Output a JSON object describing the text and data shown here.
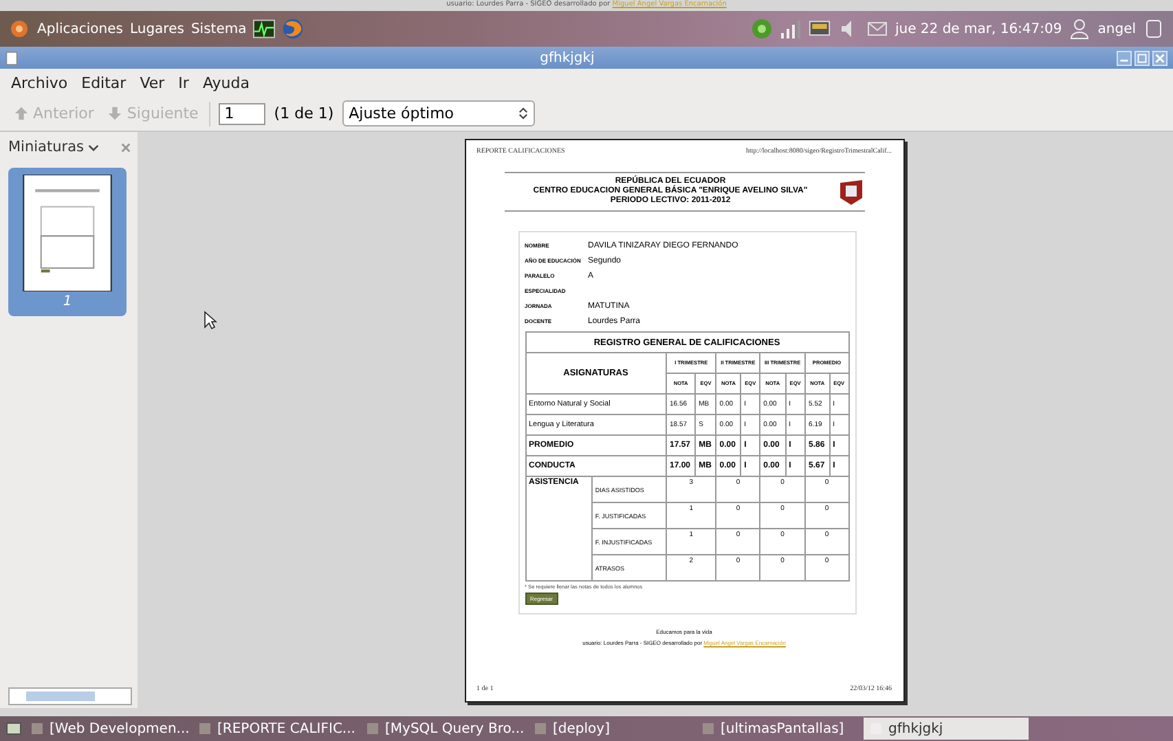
{
  "top_panel": {
    "banner": "usuario: Lourdes Parra - SIGEO desarrollado por",
    "banner_link": "Miguel Angel Vargas Encarnación",
    "menus": [
      "Aplicaciones",
      "Lugares",
      "Sistema"
    ],
    "clock": "jue 22 de mar, 16:47:09",
    "user": "angel"
  },
  "window": {
    "title": "gfhkjgkj"
  },
  "menu_bar": [
    "Archivo",
    "Editar",
    "Ver",
    "Ir",
    "Ayuda"
  ],
  "toolbar": {
    "buttons": [
      {
        "label": "Anterior",
        "kind": "up",
        "disabled": true
      },
      {
        "label": "Siguiente",
        "kind": "down",
        "disabled": true
      }
    ],
    "page_field": "1",
    "page_count": "(1 de 1)",
    "zoom": "Ajuste óptimo"
  },
  "sidebar": {
    "title": "Miniaturas",
    "thumbnails": [
      {
        "label": "1",
        "selected": true
      }
    ]
  },
  "document": {
    "header_left": "REPORTE CALIFICACIONES",
    "header_right": "http://localhost:8080/sigeo/RegistroTrimestralCalif...",
    "title_lines": [
      "REPÚBLICA DEL ECUADOR",
      "CENTRO EDUCACION GENERAL BÁSICA \"ENRIQUE AVELINO SILVA\"",
      "PERIODO LECTIVO: 2011-2012"
    ],
    "fields": [
      {
        "label": "NOMBRE",
        "value": "DAVILA TINIZARAY DIEGO FERNANDO"
      },
      {
        "label": "AÑO DE EDUCACIÓN",
        "value": "Segundo"
      },
      {
        "label": "PARALELO",
        "value": "A"
      },
      {
        "label": "ESPECIALIDAD"
      },
      {
        "label": "JORNADA",
        "value": "MATUTINA"
      },
      {
        "label": "DOCENTE",
        "value": "Lourdes Parra"
      }
    ],
    "table": {
      "title": "REGISTRO GENERAL DE CALIFICACIONES",
      "subject_header": "ASIGNATURAS",
      "terms": [
        "I TRIMESTRE",
        "II TRIMESTRE",
        "III TRIMESTRE",
        "PROMEDIO"
      ],
      "subheaders": [
        "NOTA",
        "EQV",
        "NOTA",
        "EQV",
        "NOTA",
        "EQV",
        "NOTA",
        "EQV"
      ],
      "rows": [
        {
          "subject": "Entorno Natural y Social",
          "kind": "subject",
          "cells": [
            "16.56",
            "MB",
            "0.00",
            "I",
            "0.00",
            "I",
            "5.52",
            "I"
          ]
        },
        {
          "subject": "Lengua y Literatura",
          "kind": "subject",
          "cells": [
            "18.57",
            "S",
            "0.00",
            "I",
            "0.00",
            "I",
            "6.19",
            "I"
          ]
        },
        {
          "subject": "PROMEDIO",
          "kind": "summary",
          "cells": [
            "17.57",
            "MB",
            "0.00",
            "I",
            "0.00",
            "I",
            "5.86",
            "I"
          ]
        },
        {
          "subject": "CONDUCTA",
          "kind": "summary",
          "cells": [
            "17.00",
            "MB",
            "0.00",
            "I",
            "0.00",
            "I",
            "5.67",
            "I"
          ]
        }
      ],
      "attendance": {
        "label": "ASISTENCIA",
        "rows": [
          {
            "label": "DIAS ASISTIDOS",
            "values": [
              "3",
              "0",
              "0",
              "0"
            ]
          },
          {
            "label": "F. JUSTIFICADAS",
            "values": [
              "1",
              "0",
              "0",
              "0"
            ]
          },
          {
            "label": "F. INJUSTIFICADAS",
            "values": [
              "1",
              "0",
              "0",
              "0"
            ]
          },
          {
            "label": "ATRASOS",
            "values": [
              "2",
              "0",
              "0",
              "0"
            ]
          }
        ]
      }
    },
    "note": "* Se requiere llenar las notas de todos los alumnos",
    "button": "Regresar",
    "footer_motto": "Educamos para la vida",
    "footer_credit": "usuario: Lourdes Parra - SIGEO desarrollado por",
    "footer_link": "Miguel Angel Vargas Encarnación",
    "page_footer_left": "1 de 1",
    "page_footer_right": "22/03/12 16:46"
  },
  "taskbar": [
    {
      "label": "[Web Developmen...",
      "selected": false
    },
    {
      "label": "[REPORTE CALIFIC...",
      "selected": false
    },
    {
      "label": "[MySQL Query Bro...",
      "selected": false
    },
    {
      "label": "[deploy]",
      "selected": false
    },
    {
      "label": "[ultimasPantallas]",
      "selected": false
    },
    {
      "label": "gfhkjgkj",
      "selected": true
    }
  ]
}
